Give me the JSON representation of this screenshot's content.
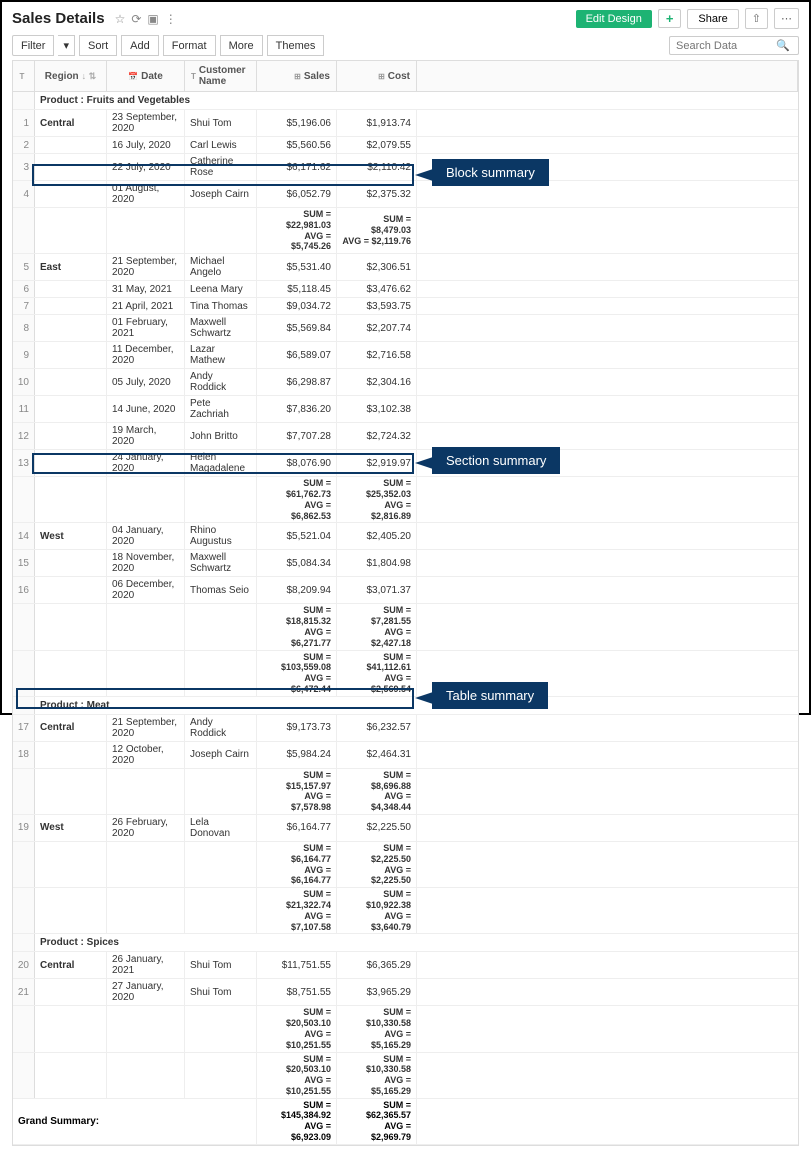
{
  "header": {
    "title": "Sales Details",
    "edit_btn": "Edit Design",
    "share_btn": "Share"
  },
  "toolbar": {
    "filter": "Filter",
    "sort": "Sort",
    "add": "Add",
    "format": "Format",
    "more": "More",
    "themes": "Themes",
    "search_placeholder": "Search Data"
  },
  "columns": {
    "region": "Region",
    "date": "Date",
    "customer": "Customer Name",
    "sales": "Sales",
    "cost": "Cost"
  },
  "groups": [
    {
      "label": "Product : Fruits and Vegetables",
      "blocks": [
        {
          "region": "Central",
          "rows": [
            {
              "n": "1",
              "date": "23 September, 2020",
              "cust": "Shui Tom",
              "sales": "$5,196.06",
              "cost": "$1,913.74"
            },
            {
              "n": "2",
              "date": "16 July, 2020",
              "cust": "Carl Lewis",
              "sales": "$5,560.56",
              "cost": "$2,079.55"
            },
            {
              "n": "3",
              "date": "22 July, 2020",
              "cust": "Catherine Rose",
              "sales": "$6,171.62",
              "cost": "$2,110.42"
            },
            {
              "n": "4",
              "date": "01 August, 2020",
              "cust": "Joseph Cairn",
              "sales": "$6,052.79",
              "cost": "$2,375.32"
            }
          ],
          "sum_sales": "SUM = $22,981.03",
          "avg_sales": "AVG = $5,745.26",
          "sum_cost": "SUM = $8,479.03",
          "avg_cost": "AVG = $2,119.76"
        },
        {
          "region": "East",
          "rows": [
            {
              "n": "5",
              "date": "21 September, 2020",
              "cust": "Michael Angelo",
              "sales": "$5,531.40",
              "cost": "$2,306.51"
            },
            {
              "n": "6",
              "date": "31 May, 2021",
              "cust": "Leena Mary",
              "sales": "$5,118.45",
              "cost": "$3,476.62"
            },
            {
              "n": "7",
              "date": "21 April, 2021",
              "cust": "Tina Thomas",
              "sales": "$9,034.72",
              "cost": "$3,593.75"
            },
            {
              "n": "8",
              "date": "01 February, 2021",
              "cust": "Maxwell Schwartz",
              "sales": "$5,569.84",
              "cost": "$2,207.74"
            },
            {
              "n": "9",
              "date": "11 December, 2020",
              "cust": "Lazar Mathew",
              "sales": "$6,589.07",
              "cost": "$2,716.58"
            },
            {
              "n": "10",
              "date": "05 July, 2020",
              "cust": "Andy Roddick",
              "sales": "$6,298.87",
              "cost": "$2,304.16"
            },
            {
              "n": "11",
              "date": "14 June, 2020",
              "cust": "Pete Zachriah",
              "sales": "$7,836.20",
              "cost": "$3,102.38"
            },
            {
              "n": "12",
              "date": "19 March, 2020",
              "cust": "John Britto",
              "sales": "$7,707.28",
              "cost": "$2,724.32"
            },
            {
              "n": "13",
              "date": "24 January, 2020",
              "cust": "Helen Magadalene",
              "sales": "$8,076.90",
              "cost": "$2,919.97"
            }
          ],
          "sum_sales": "SUM = $61,762.73",
          "avg_sales": "AVG = $6,862.53",
          "sum_cost": "SUM = $25,352.03",
          "avg_cost": "AVG = $2,816.89"
        },
        {
          "region": "West",
          "rows": [
            {
              "n": "14",
              "date": "04 January, 2020",
              "cust": "Rhino Augustus",
              "sales": "$5,521.04",
              "cost": "$2,405.20"
            },
            {
              "n": "15",
              "date": "18 November, 2020",
              "cust": "Maxwell Schwartz",
              "sales": "$5,084.34",
              "cost": "$1,804.98"
            },
            {
              "n": "16",
              "date": "06 December, 2020",
              "cust": "Thomas Seio",
              "sales": "$8,209.94",
              "cost": "$3,071.37"
            }
          ],
          "sum_sales": "SUM = $18,815.32",
          "avg_sales": "AVG = $6,271.77",
          "sum_cost": "SUM = $7,281.55",
          "avg_cost": "AVG = $2,427.18"
        }
      ],
      "section_sum_sales": "SUM = $103,559.08",
      "section_avg_sales": "AVG = $6,472.44",
      "section_sum_cost": "SUM = $41,112.61",
      "section_avg_cost": "AVG = $2,569.54"
    },
    {
      "label": "Product : Meat",
      "blocks": [
        {
          "region": "Central",
          "rows": [
            {
              "n": "17",
              "date": "21 September, 2020",
              "cust": "Andy Roddick",
              "sales": "$9,173.73",
              "cost": "$6,232.57"
            },
            {
              "n": "18",
              "date": "12 October, 2020",
              "cust": "Joseph Cairn",
              "sales": "$5,984.24",
              "cost": "$2,464.31"
            }
          ],
          "sum_sales": "SUM = $15,157.97",
          "avg_sales": "AVG = $7,578.98",
          "sum_cost": "SUM = $8,696.88",
          "avg_cost": "AVG = $4,348.44"
        },
        {
          "region": "West",
          "rows": [
            {
              "n": "19",
              "date": "26 February, 2020",
              "cust": "Lela Donovan",
              "sales": "$6,164.77",
              "cost": "$2,225.50"
            }
          ],
          "sum_sales": "SUM = $6,164.77",
          "avg_sales": "AVG = $6,164.77",
          "sum_cost": "SUM = $2,225.50",
          "avg_cost": "AVG = $2,225.50"
        }
      ],
      "section_sum_sales": "SUM = $21,322.74",
      "section_avg_sales": "AVG = $7,107.58",
      "section_sum_cost": "SUM = $10,922.38",
      "section_avg_cost": "AVG = $3,640.79"
    },
    {
      "label": "Product : Spices",
      "blocks": [
        {
          "region": "Central",
          "rows": [
            {
              "n": "20",
              "date": "26 January, 2021",
              "cust": "Shui Tom",
              "sales": "$11,751.55",
              "cost": "$6,365.29"
            },
            {
              "n": "21",
              "date": "27 January, 2020",
              "cust": "Shui Tom",
              "sales": "$8,751.55",
              "cost": "$3,965.29"
            }
          ],
          "sum_sales": "SUM = $20,503.10",
          "avg_sales": "AVG = $10,251.55",
          "sum_cost": "SUM = $10,330.58",
          "avg_cost": "AVG = $5,165.29"
        }
      ],
      "section_sum_sales": "SUM = $20,503.10",
      "section_avg_sales": "AVG = $10,251.55",
      "section_sum_cost": "SUM = $10,330.58",
      "section_avg_cost": "AVG = $5,165.29"
    }
  ],
  "grand": {
    "label": "Grand Summary:",
    "sum_sales": "SUM = $145,384.92",
    "avg_sales": "AVG = $6,923.09",
    "sum_cost": "SUM = $62,365.57",
    "avg_cost": "AVG = $2,969.79"
  },
  "callouts": {
    "block": "Block summary",
    "section": "Section summary",
    "table": "Table summary"
  }
}
